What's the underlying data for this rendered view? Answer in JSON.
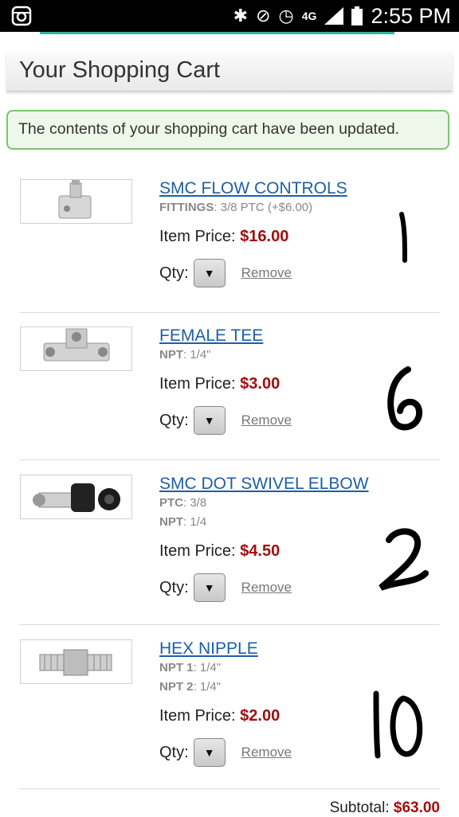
{
  "status_bar": {
    "time": "2:55 PM",
    "network": "4G",
    "icons": [
      "instagram-icon",
      "bluetooth-icon",
      "mute-icon",
      "alarm-icon",
      "signal-icon",
      "battery-icon"
    ]
  },
  "header": {
    "title": "Your Shopping Cart"
  },
  "notice": {
    "text": "The contents of your shopping cart have been updated."
  },
  "labels": {
    "item_price": "Item Price:",
    "qty": "Qty:",
    "remove": "Remove",
    "subtotal": "Subtotal:"
  },
  "items": [
    {
      "name": "SMC FLOW CONTROLS",
      "options": [
        {
          "label": "FITTINGS",
          "value": ": 3/8 PTC (+$6.00)"
        }
      ],
      "price": "$16.00",
      "handwritten_qty": "1",
      "image": "flow-control-image"
    },
    {
      "name": "FEMALE TEE",
      "options": [
        {
          "label": "NPT",
          "value": ": 1/4\""
        }
      ],
      "price": "$3.00",
      "handwritten_qty": "6",
      "image": "female-tee-image"
    },
    {
      "name": "SMC DOT SWIVEL ELBOW",
      "options": [
        {
          "label": "PTC",
          "value": ": 3/8"
        },
        {
          "label": "NPT",
          "value": ": 1/4"
        }
      ],
      "price": "$4.50",
      "handwritten_qty": "2",
      "image": "swivel-elbow-image"
    },
    {
      "name": "HEX NIPPLE",
      "options": [
        {
          "label": "NPT 1",
          "value": ": 1/4\""
        },
        {
          "label": "NPT 2",
          "value": ": 1/4\""
        }
      ],
      "price": "$2.00",
      "handwritten_qty": "10",
      "image": "hex-nipple-image"
    }
  ],
  "subtotal": "$63.00",
  "colors": {
    "link": "#1d5fa6",
    "price": "#a10f0f",
    "notice_border": "#7bc66b",
    "statusbar_accent": "#2fb59a"
  }
}
